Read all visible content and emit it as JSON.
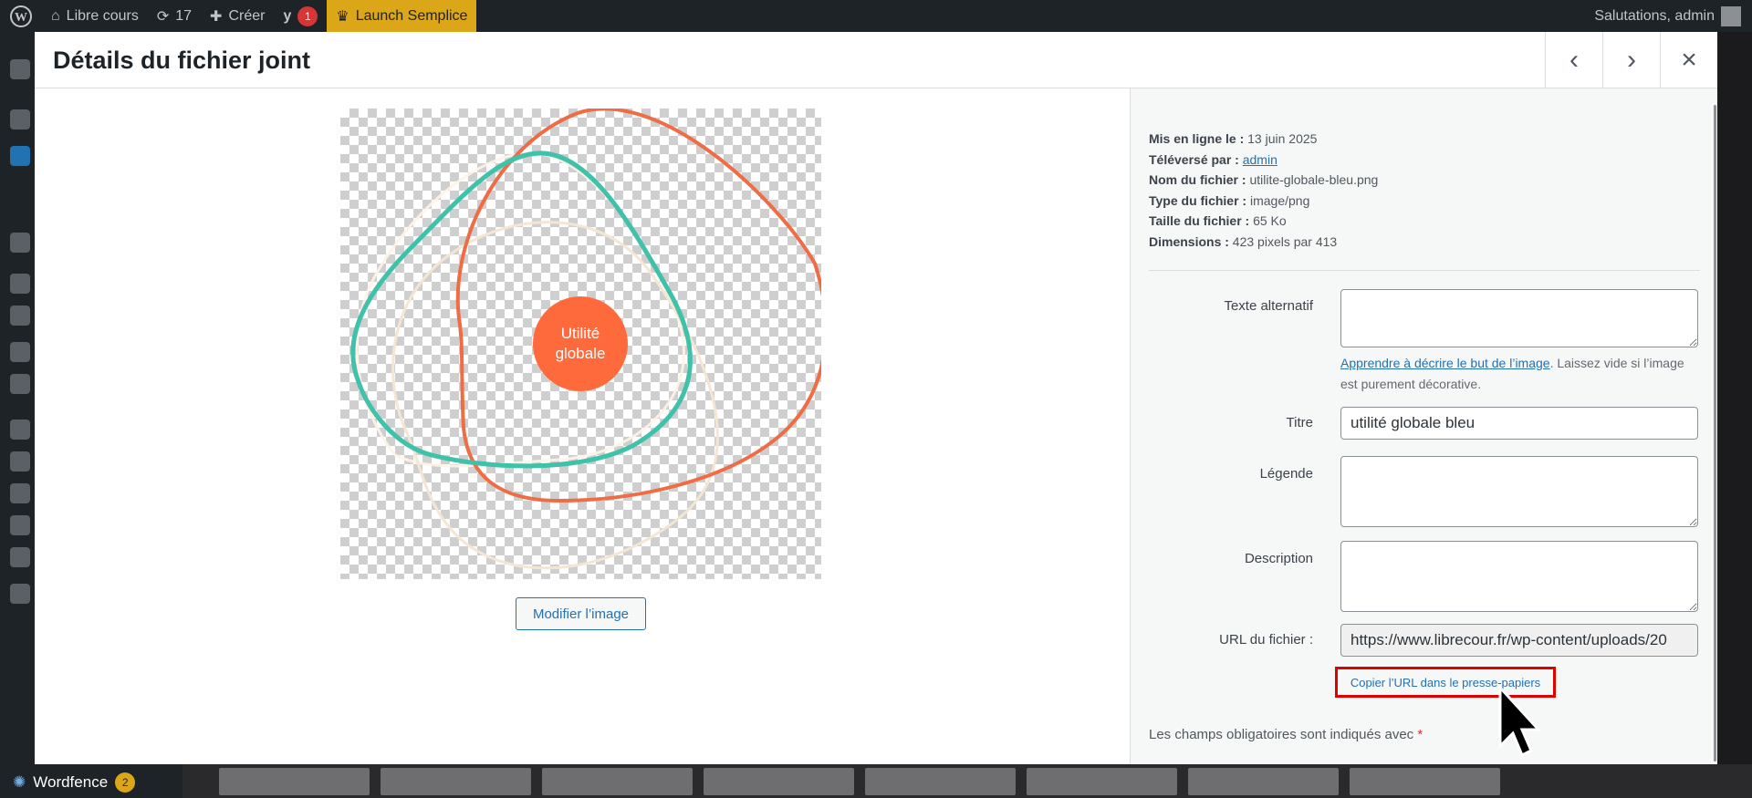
{
  "adminbar": {
    "site_name": "Libre cours",
    "updates_count": "17",
    "new_label": "Créer",
    "yoast_count": "1",
    "launch_label": "Launch Semplice",
    "greeting": "Salutations, admin"
  },
  "sidebar": {
    "wordfence_label": "Wordfence",
    "wordfence_count": "2"
  },
  "modal": {
    "title": "Détails du fichier joint",
    "prev_label": "‹",
    "next_label": "›",
    "close_label": "×"
  },
  "media": {
    "image_text_line1": "Utilité",
    "image_text_line2": "globale",
    "edit_button": "Modifier l’image"
  },
  "details": {
    "uploaded_on_label": "Mis en ligne le :",
    "uploaded_on_value": "13 juin 2025",
    "uploaded_by_label": "Téléversé par :",
    "uploaded_by_value": "admin",
    "file_name_label": "Nom du fichier :",
    "file_name_value": "utilite-globale-bleu.png",
    "file_type_label": "Type du fichier :",
    "file_type_value": "image/png",
    "file_size_label": "Taille du fichier :",
    "file_size_value": "65 Ko",
    "dimensions_label": "Dimensions :",
    "dimensions_value": "423 pixels par 413"
  },
  "form": {
    "alt_label": "Texte alternatif",
    "alt_value": "",
    "alt_help_link": "Apprendre à décrire le but de l’image",
    "alt_help_rest": ". Laissez vide si l’image est purement décorative.",
    "title_label": "Titre",
    "title_value": "utilité globale bleu",
    "caption_label": "Légende",
    "caption_value": "",
    "description_label": "Description",
    "description_value": "",
    "url_label": "URL du fichier :",
    "url_value": "https://www.librecour.fr/wp-content/uploads/20",
    "copy_button": "Copier l’URL dans le presse-papiers",
    "required_note": "Les champs obligatoires sont indiqués avec",
    "required_star": "*"
  }
}
